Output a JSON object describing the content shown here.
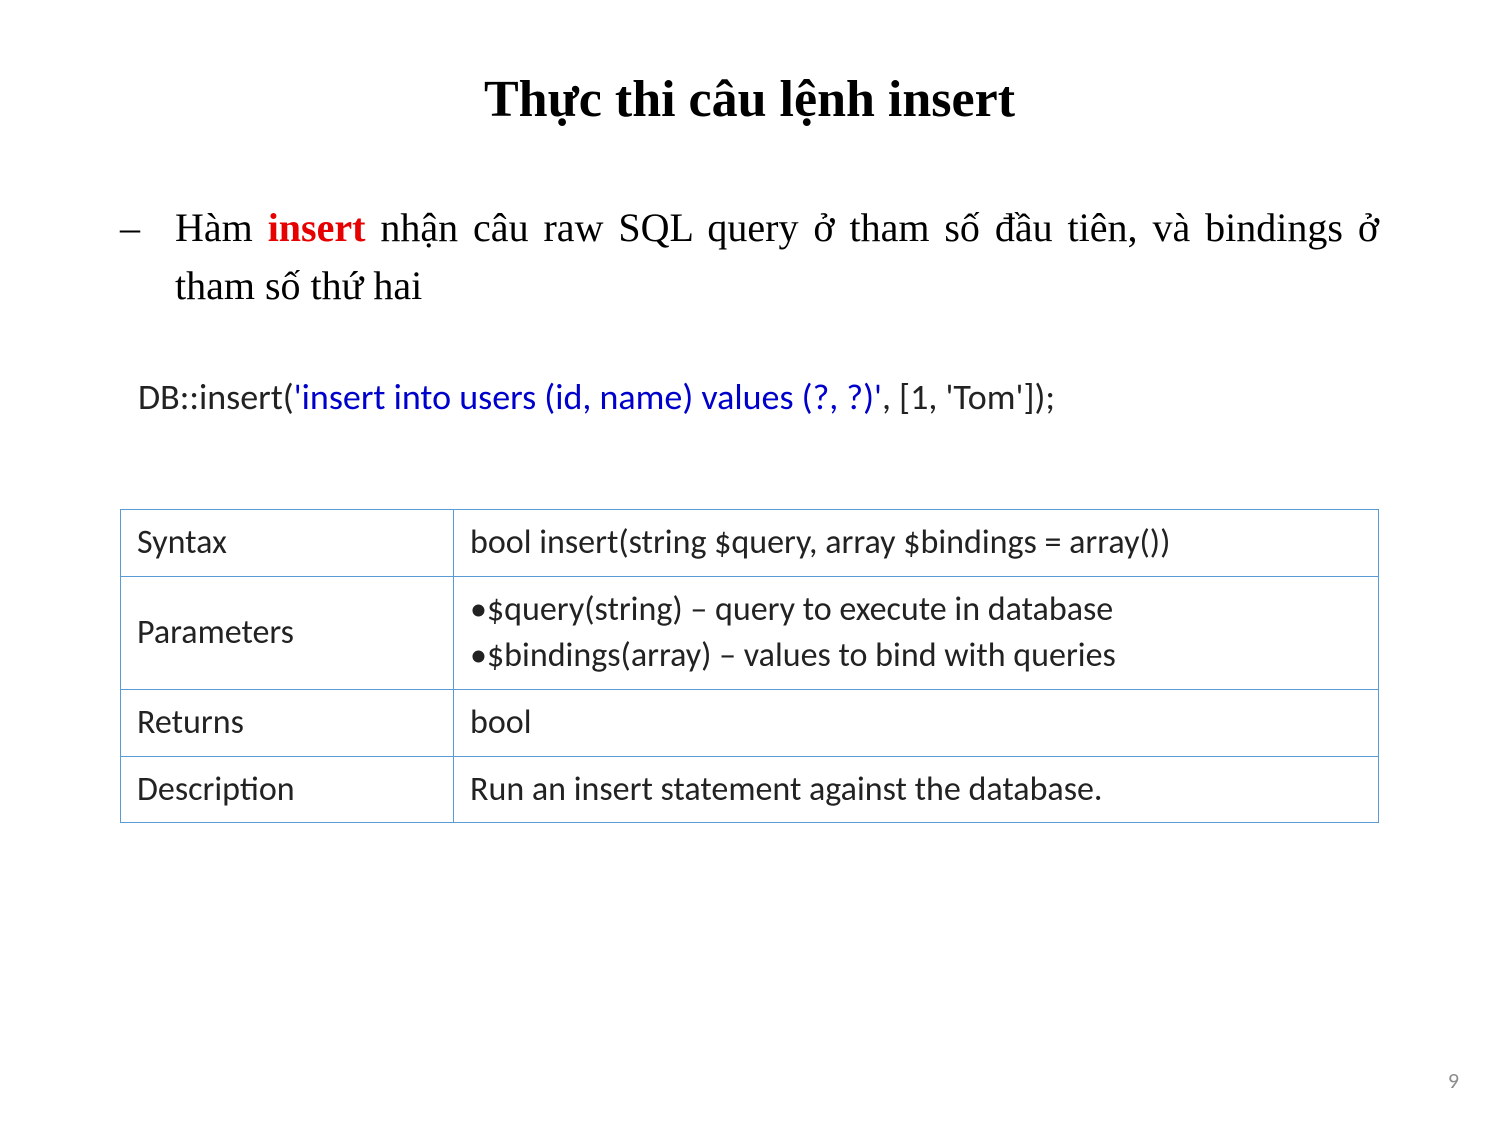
{
  "title": "Thực thi câu lệnh insert",
  "bullet": {
    "dash": "–",
    "pre": "Hàm ",
    "keyword": "insert",
    "post": " nhận câu raw SQL query ở tham số đầu tiên, và bindings ở tham số thứ hai"
  },
  "code": {
    "prefix": "DB::insert(",
    "sql": "'insert into users (id, name) values (?, ?)'",
    "suffix": ", [1, 'Tom']);"
  },
  "table": {
    "syntax_label": "Syntax",
    "syntax_value": "bool insert(string $query, array $bindings = array())",
    "parameters_label": "Parameters",
    "parameters_line1": "•$query(string) – query to execute in database",
    "parameters_line2": "•$bindings(array) – values to bind with queries",
    "returns_label": "Returns",
    "returns_value": "bool",
    "description_label": "Description",
    "description_value": "Run an insert statement against the database."
  },
  "page_number": "9"
}
